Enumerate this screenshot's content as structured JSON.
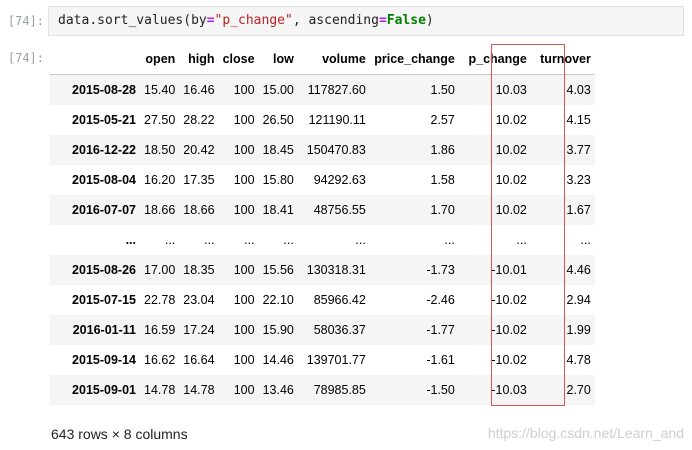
{
  "cell": {
    "in_prompt": "[74]:",
    "out_prompt": "[74]:",
    "code": {
      "obj": "data",
      "dot": ".",
      "method": "sort_values",
      "open_paren": "(",
      "arg1_name": "by",
      "eq1": "=",
      "arg1_value": "\"p_change\"",
      "comma": ", ",
      "arg2_name": "ascending",
      "eq2": "=",
      "arg2_value": "False",
      "close_paren": ")"
    }
  },
  "table": {
    "columns": [
      "open",
      "high",
      "close",
      "low",
      "volume",
      "price_change",
      "p_change",
      "turnover"
    ],
    "rows": [
      {
        "index": "2015-08-28",
        "values": [
          "15.40",
          "16.46",
          "100",
          "15.00",
          "117827.60",
          "1.50",
          "10.03",
          "4.03"
        ]
      },
      {
        "index": "2015-05-21",
        "values": [
          "27.50",
          "28.22",
          "100",
          "26.50",
          "121190.11",
          "2.57",
          "10.02",
          "4.15"
        ]
      },
      {
        "index": "2016-12-22",
        "values": [
          "18.50",
          "20.42",
          "100",
          "18.45",
          "150470.83",
          "1.86",
          "10.02",
          "3.77"
        ]
      },
      {
        "index": "2015-08-04",
        "values": [
          "16.20",
          "17.35",
          "100",
          "15.80",
          "94292.63",
          "1.58",
          "10.02",
          "3.23"
        ]
      },
      {
        "index": "2016-07-07",
        "values": [
          "18.66",
          "18.66",
          "100",
          "18.41",
          "48756.55",
          "1.70",
          "10.02",
          "1.67"
        ]
      },
      {
        "index": "...",
        "values": [
          "...",
          "...",
          "...",
          "...",
          "...",
          "...",
          "...",
          "..."
        ]
      },
      {
        "index": "2015-08-26",
        "values": [
          "17.00",
          "18.35",
          "100",
          "15.56",
          "130318.31",
          "-1.73",
          "-10.01",
          "4.46"
        ]
      },
      {
        "index": "2015-07-15",
        "values": [
          "22.78",
          "23.04",
          "100",
          "22.10",
          "85966.42",
          "-2.46",
          "-10.02",
          "2.94"
        ]
      },
      {
        "index": "2016-01-11",
        "values": [
          "16.59",
          "17.24",
          "100",
          "15.90",
          "58036.37",
          "-1.77",
          "-10.02",
          "1.99"
        ]
      },
      {
        "index": "2015-09-14",
        "values": [
          "16.62",
          "16.64",
          "100",
          "14.46",
          "139701.77",
          "-1.61",
          "-10.02",
          "4.78"
        ]
      },
      {
        "index": "2015-09-01",
        "values": [
          "14.78",
          "14.78",
          "100",
          "13.46",
          "78985.85",
          "-1.50",
          "-10.03",
          "2.70"
        ]
      }
    ]
  },
  "footer": {
    "shape": "643 rows × 8 columns",
    "watermark": "https://blog.csdn.net/Learn_and"
  },
  "colors": {
    "highlight_border": "#d9534f",
    "stripe": "#f5f5f5",
    "code_bg": "#f5f5f5"
  }
}
